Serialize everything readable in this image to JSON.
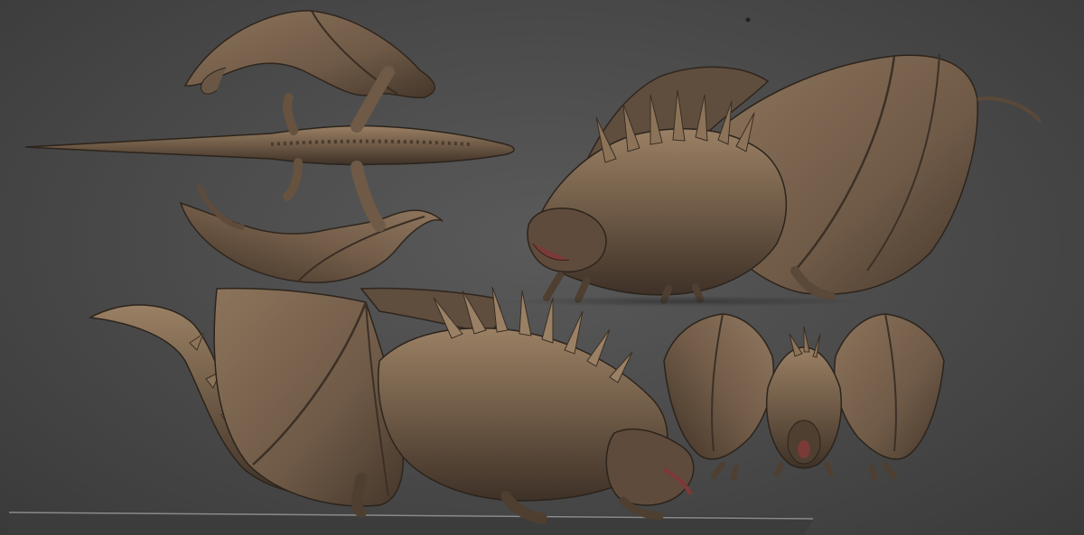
{
  "scene": {
    "views": [
      {
        "id": "top"
      },
      {
        "id": "front-three-quarter"
      },
      {
        "id": "side-crouch"
      },
      {
        "id": "front"
      }
    ]
  },
  "colors": {
    "background": "#4a4a4a",
    "skin_base": "#6e5a46",
    "skin_dark": "#3e3127",
    "skin_light": "#9a8064",
    "wing_membrane": "#7a6450",
    "mouth": "#7a3a38"
  }
}
